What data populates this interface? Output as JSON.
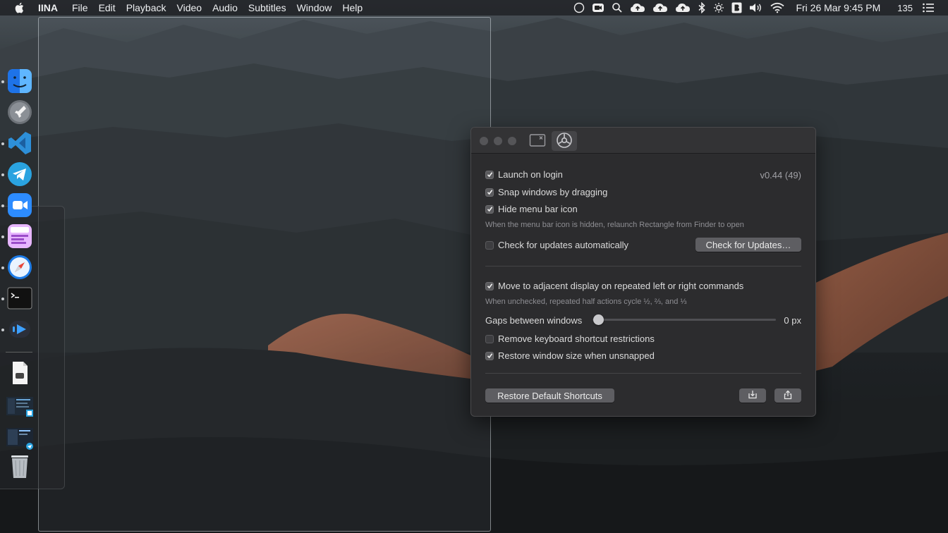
{
  "menubar": {
    "app_name": "IINA",
    "items": [
      "File",
      "Edit",
      "Playback",
      "Video",
      "Audio",
      "Subtitles",
      "Window",
      "Help"
    ],
    "status_icons": [
      "clock-circle-icon",
      "zoom-icon",
      "search-icon",
      "cloud-upload-icon",
      "cloud-upload-icon",
      "cloud-upload-icon",
      "bluetooth-icon",
      "brightness-icon",
      "b-app-icon",
      "volume-icon",
      "wifi-icon"
    ],
    "clock": "Fri 26 Mar  9:45 PM",
    "count": "135",
    "list_icon": "list-icon"
  },
  "dock": {
    "apps": [
      {
        "name": "finder-icon",
        "running": true
      },
      {
        "name": "launchpad-icon",
        "running": false
      },
      {
        "name": "vscode-icon",
        "running": true
      },
      {
        "name": "telegram-icon",
        "running": true
      },
      {
        "name": "zoom-icon",
        "running": true
      },
      {
        "name": "notes-app-icon",
        "running": true
      },
      {
        "name": "safari-icon",
        "running": true
      },
      {
        "name": "terminal-icon",
        "running": true
      },
      {
        "name": "iina-icon",
        "running": true
      }
    ],
    "others": [
      "document-icon",
      "window-thumbnail-icon",
      "window-thumbnail-icon",
      "trash-icon"
    ]
  },
  "prefs": {
    "version": "v0.44 (49)",
    "launch_on_login": "Launch on login",
    "snap_windows": "Snap windows by dragging",
    "hide_menu_icon": "Hide menu bar icon",
    "hide_hint": "When the menu bar icon is hidden, relaunch Rectangle from Finder to open",
    "check_updates_auto": "Check for updates automatically",
    "check_updates_button": "Check for Updates…",
    "move_adjacent": "Move to adjacent display on repeated left or right commands",
    "adjacent_hint": "When unchecked, repeated half actions cycle ½, ⅔, and ⅓",
    "gaps_label": "Gaps between windows",
    "gaps_value": "0 px",
    "remove_restrictions": "Remove keyboard shortcut restrictions",
    "restore_size": "Restore window size when unsnapped",
    "restore_defaults_button": "Restore Default Shortcuts",
    "checks": {
      "launch_on_login": true,
      "snap_windows": true,
      "hide_menu_icon": true,
      "check_updates_auto": false,
      "move_adjacent": true,
      "remove_restrictions": false,
      "restore_size": true
    },
    "gaps_slider_value": 0
  },
  "colors": {
    "accent_telegram": "#2aa3e0",
    "accent_vscode": "#2d8fd8",
    "accent_zoom": "#2d8cff",
    "window_bg": "#2c2c2e"
  }
}
